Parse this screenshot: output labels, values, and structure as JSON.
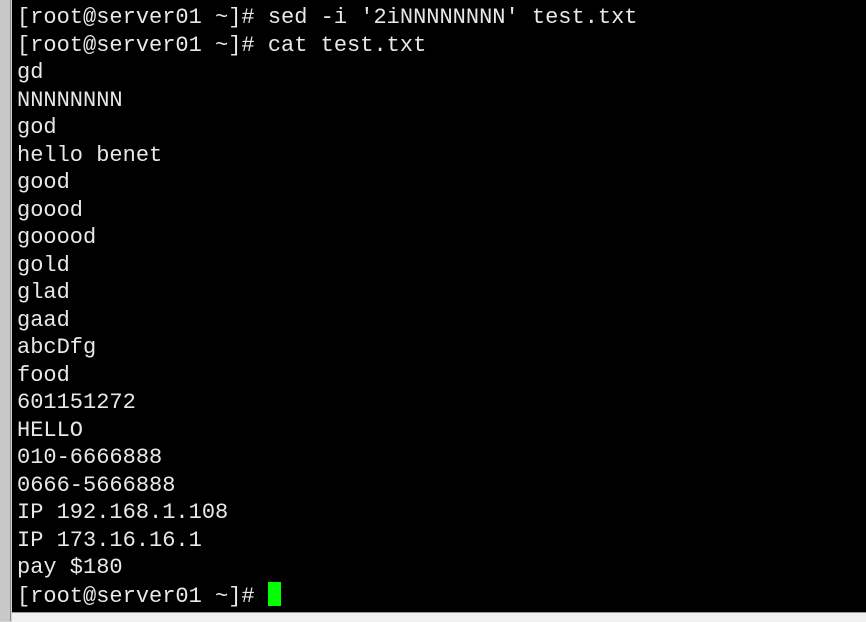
{
  "terminal": {
    "lines": [
      "[root@server01 ~]# sed -i '2iNNNNNNNN' test.txt",
      "[root@server01 ~]# cat test.txt",
      "gd",
      "NNNNNNNN",
      "god",
      "hello benet",
      "good",
      "goood",
      "gooood",
      "gold",
      "glad",
      "gaad",
      "abcDfg",
      "food",
      "601151272",
      "HELLO",
      "010-6666888",
      "0666-5666888",
      "IP 192.168.1.108",
      "IP 173.16.16.1",
      "pay $180"
    ],
    "prompt": "[root@server01 ~]# ",
    "cursor_color": "#00ff00",
    "background": "#000000"
  }
}
